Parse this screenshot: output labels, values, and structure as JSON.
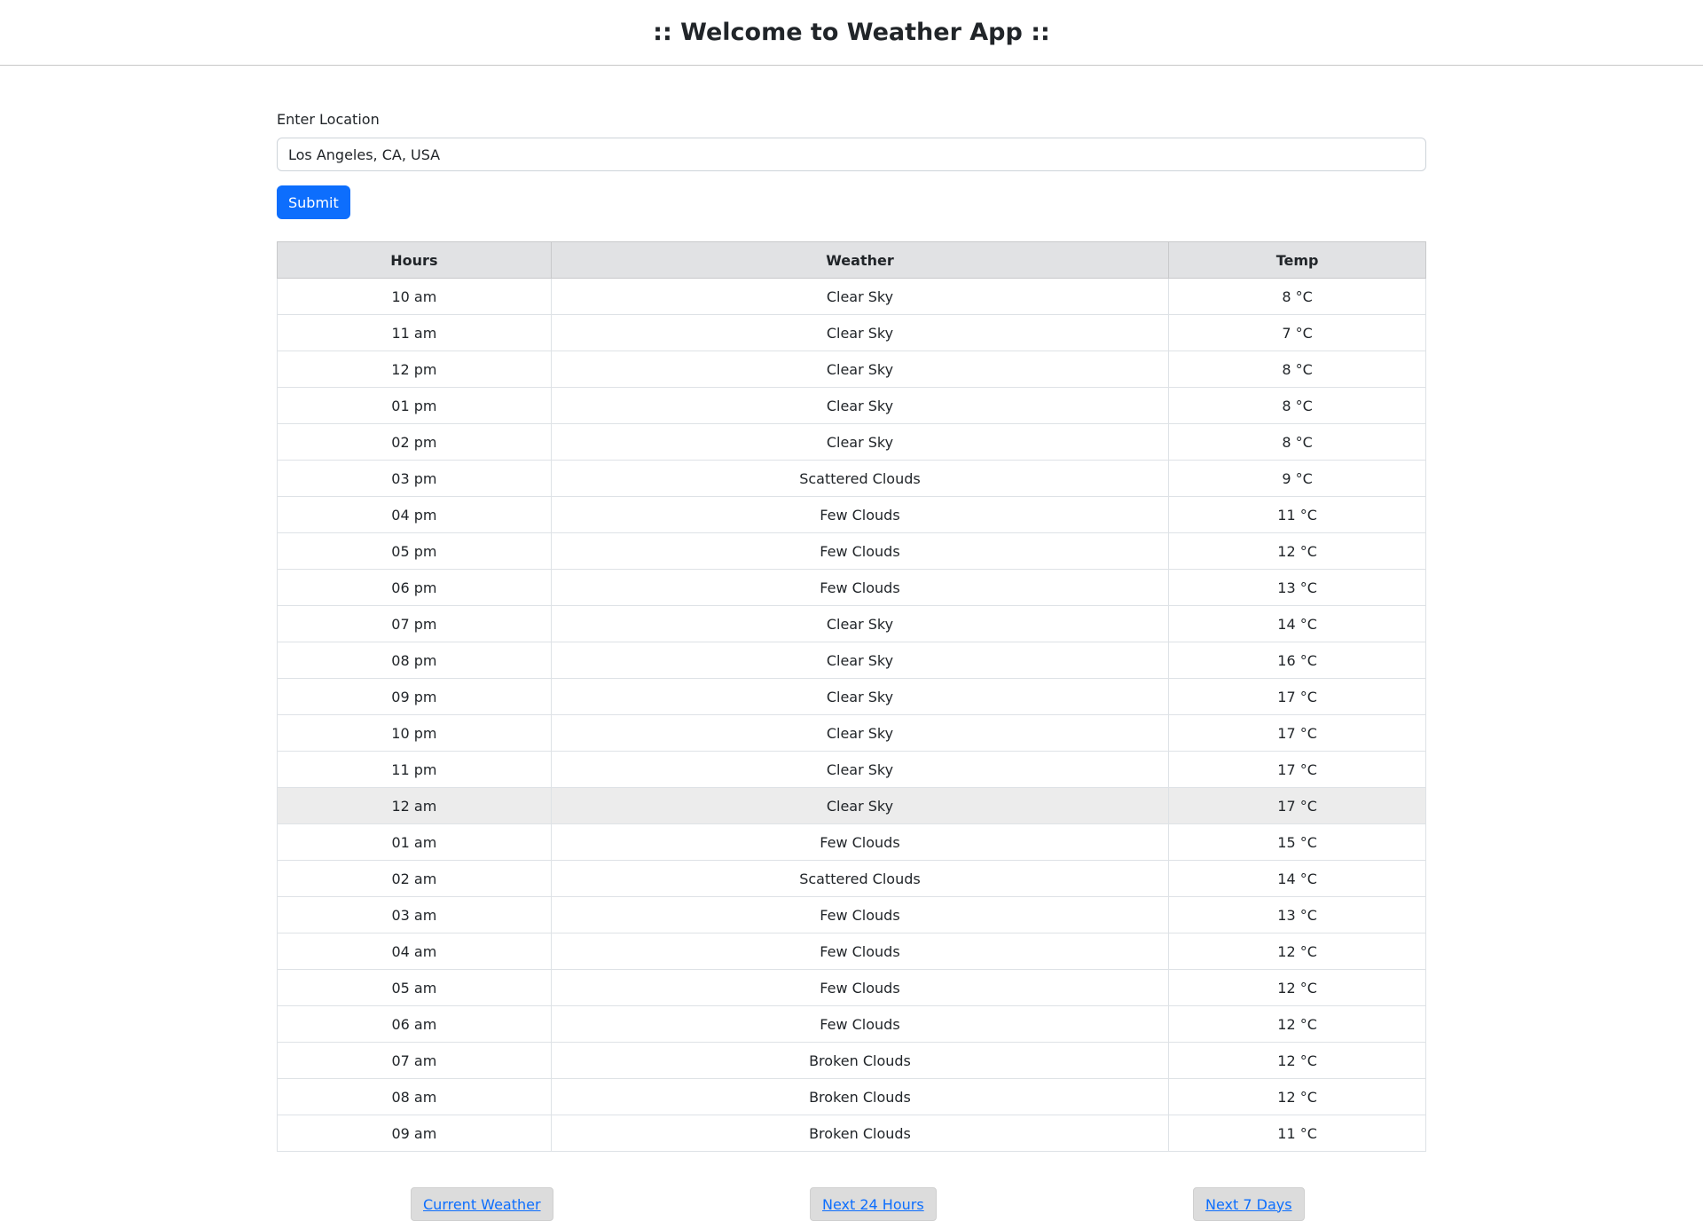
{
  "header": {
    "title": ":: Welcome to Weather App ::"
  },
  "form": {
    "label": "Enter Location",
    "location_value": "Los Angeles, CA, USA",
    "submit_label": "Submit"
  },
  "table": {
    "headers": {
      "hours": "Hours",
      "weather": "Weather",
      "temp": "Temp"
    },
    "rows": [
      {
        "hour": "10 am",
        "weather": "Clear Sky",
        "temp": "8 °C"
      },
      {
        "hour": "11 am",
        "weather": "Clear Sky",
        "temp": "7 °C"
      },
      {
        "hour": "12 pm",
        "weather": "Clear Sky",
        "temp": "8 °C"
      },
      {
        "hour": "01 pm",
        "weather": "Clear Sky",
        "temp": "8 °C"
      },
      {
        "hour": "02 pm",
        "weather": "Clear Sky",
        "temp": "8 °C"
      },
      {
        "hour": "03 pm",
        "weather": "Scattered Clouds",
        "temp": "9 °C"
      },
      {
        "hour": "04 pm",
        "weather": "Few Clouds",
        "temp": "11 °C"
      },
      {
        "hour": "05 pm",
        "weather": "Few Clouds",
        "temp": "12 °C"
      },
      {
        "hour": "06 pm",
        "weather": "Few Clouds",
        "temp": "13 °C"
      },
      {
        "hour": "07 pm",
        "weather": "Clear Sky",
        "temp": "14 °C"
      },
      {
        "hour": "08 pm",
        "weather": "Clear Sky",
        "temp": "16 °C"
      },
      {
        "hour": "09 pm",
        "weather": "Clear Sky",
        "temp": "17 °C"
      },
      {
        "hour": "10 pm",
        "weather": "Clear Sky",
        "temp": "17 °C"
      },
      {
        "hour": "11 pm",
        "weather": "Clear Sky",
        "temp": "17 °C"
      },
      {
        "hour": "12 am",
        "weather": "Clear Sky",
        "temp": "17 °C"
      },
      {
        "hour": "01 am",
        "weather": "Few Clouds",
        "temp": "15 °C"
      },
      {
        "hour": "02 am",
        "weather": "Scattered Clouds",
        "temp": "14 °C"
      },
      {
        "hour": "03 am",
        "weather": "Few Clouds",
        "temp": "13 °C"
      },
      {
        "hour": "04 am",
        "weather": "Few Clouds",
        "temp": "12 °C"
      },
      {
        "hour": "05 am",
        "weather": "Few Clouds",
        "temp": "12 °C"
      },
      {
        "hour": "06 am",
        "weather": "Few Clouds",
        "temp": "12 °C"
      },
      {
        "hour": "07 am",
        "weather": "Broken Clouds",
        "temp": "12 °C"
      },
      {
        "hour": "08 am",
        "weather": "Broken Clouds",
        "temp": "12 °C"
      },
      {
        "hour": "09 am",
        "weather": "Broken Clouds",
        "temp": "11 °C"
      }
    ],
    "highlighted_row_index": 14
  },
  "nav": {
    "current_weather": "Current Weather",
    "next_24_hours": "Next 24 Hours",
    "next_7_days": "Next 7 Days"
  }
}
